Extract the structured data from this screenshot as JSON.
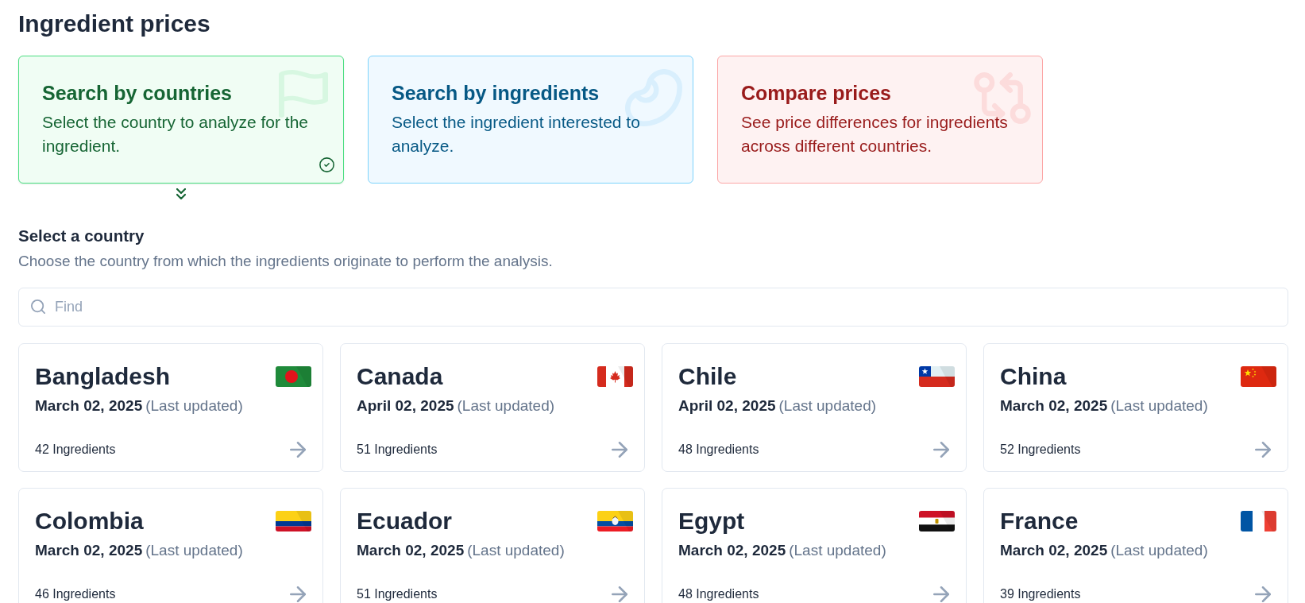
{
  "page": {
    "title": "Ingredient prices"
  },
  "modes": [
    {
      "kind": "countries",
      "title": "Search by countries",
      "description": "Select the country to analyze for the ingredient.",
      "selected": true
    },
    {
      "kind": "ingredients",
      "title": "Search by ingredients",
      "description": "Select the ingredient interested to analyze.",
      "selected": false
    },
    {
      "kind": "compare",
      "title": "Compare prices",
      "description": "See price differences for ingredients across different countries.",
      "selected": false
    }
  ],
  "country_section": {
    "heading": "Select a country",
    "description": "Choose the country from which the ingredients originate to perform the analysis.",
    "search": {
      "placeholder": "Find"
    }
  },
  "countries": [
    {
      "name": "Bangladesh",
      "date": "March 02, 2025",
      "date_note": "(Last updated)",
      "ingredients": "42 Ingredients"
    },
    {
      "name": "Canada",
      "date": "April 02, 2025",
      "date_note": "(Last updated)",
      "ingredients": "51 Ingredients"
    },
    {
      "name": "Chile",
      "date": "April 02, 2025",
      "date_note": "(Last updated)",
      "ingredients": "48 Ingredients"
    },
    {
      "name": "China",
      "date": "March 02, 2025",
      "date_note": "(Last updated)",
      "ingredients": "52 Ingredients"
    },
    {
      "name": "Colombia",
      "date": "March 02, 2025",
      "date_note": "(Last updated)",
      "ingredients": "46 Ingredients"
    },
    {
      "name": "Ecuador",
      "date": "March 02, 2025",
      "date_note": "(Last updated)",
      "ingredients": "51 Ingredients"
    },
    {
      "name": "Egypt",
      "date": "March 02, 2025",
      "date_note": "(Last updated)",
      "ingredients": "48 Ingredients"
    },
    {
      "name": "France",
      "date": "March 02, 2025",
      "date_note": "(Last updated)",
      "ingredients": "39 Ingredients"
    }
  ]
}
